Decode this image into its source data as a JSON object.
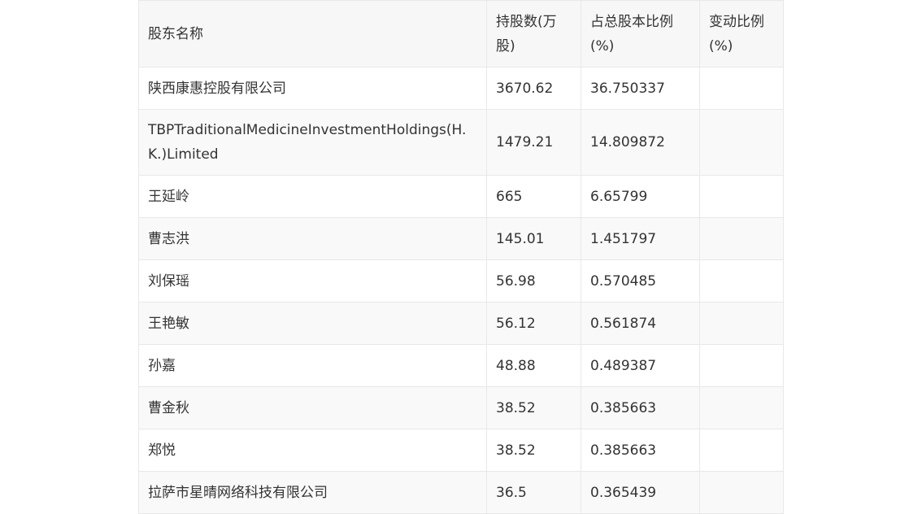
{
  "table": {
    "headers": [
      "股东名称",
      "持股数(万股)",
      "占总股本比例(%)",
      "变动比例(%)"
    ],
    "rows": [
      {
        "name": "陕西康惠控股有限公司",
        "shares": "3670.62",
        "ratio": "36.750337",
        "change": ""
      },
      {
        "name": "TBPTraditionalMedicineInvestmentHoldings(H.K.)Limited",
        "shares": "1479.21",
        "ratio": "14.809872",
        "change": ""
      },
      {
        "name": "王延岭",
        "shares": "665",
        "ratio": "6.65799",
        "change": ""
      },
      {
        "name": "曹志洪",
        "shares": "145.01",
        "ratio": "1.451797",
        "change": ""
      },
      {
        "name": "刘保瑶",
        "shares": "56.98",
        "ratio": "0.570485",
        "change": ""
      },
      {
        "name": "王艳敏",
        "shares": "56.12",
        "ratio": "0.561874",
        "change": ""
      },
      {
        "name": "孙嘉",
        "shares": "48.88",
        "ratio": "0.489387",
        "change": ""
      },
      {
        "name": "曹金秋",
        "shares": "38.52",
        "ratio": "0.385663",
        "change": ""
      },
      {
        "name": "郑悦",
        "shares": "38.52",
        "ratio": "0.385663",
        "change": ""
      },
      {
        "name": "拉萨市星晴网络科技有限公司",
        "shares": "36.5",
        "ratio": "0.365439",
        "change": ""
      }
    ]
  }
}
